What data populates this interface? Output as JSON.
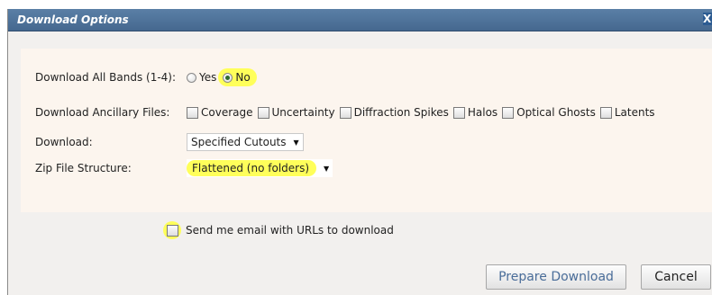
{
  "dialog": {
    "title": "Download Options",
    "close_label": "X"
  },
  "bands": {
    "label": "Download All Bands (1-4):",
    "options": [
      {
        "label": "Yes",
        "selected": false
      },
      {
        "label": "No",
        "selected": true
      }
    ]
  },
  "ancillary": {
    "label": "Download Ancillary Files:",
    "items": [
      {
        "label": "Coverage",
        "checked": false
      },
      {
        "label": "Uncertainty",
        "checked": false
      },
      {
        "label": "Diffraction Spikes",
        "checked": false
      },
      {
        "label": "Halos",
        "checked": false
      },
      {
        "label": "Optical Ghosts",
        "checked": false
      },
      {
        "label": "Latents",
        "checked": false
      }
    ]
  },
  "download": {
    "label": "Download:",
    "selected": "Specified Cutouts"
  },
  "zip": {
    "label": "Zip File Structure:",
    "selected": "Flattened (no folders)"
  },
  "email": {
    "label": "Send me email with URLs to download",
    "checked": false
  },
  "buttons": {
    "prepare": "Prepare Download",
    "cancel": "Cancel"
  },
  "colors": {
    "titlebar": "#4f7399",
    "panel": "#fcf5ee",
    "highlight": "#ffff5a",
    "prepare_text": "#4a6d99"
  }
}
